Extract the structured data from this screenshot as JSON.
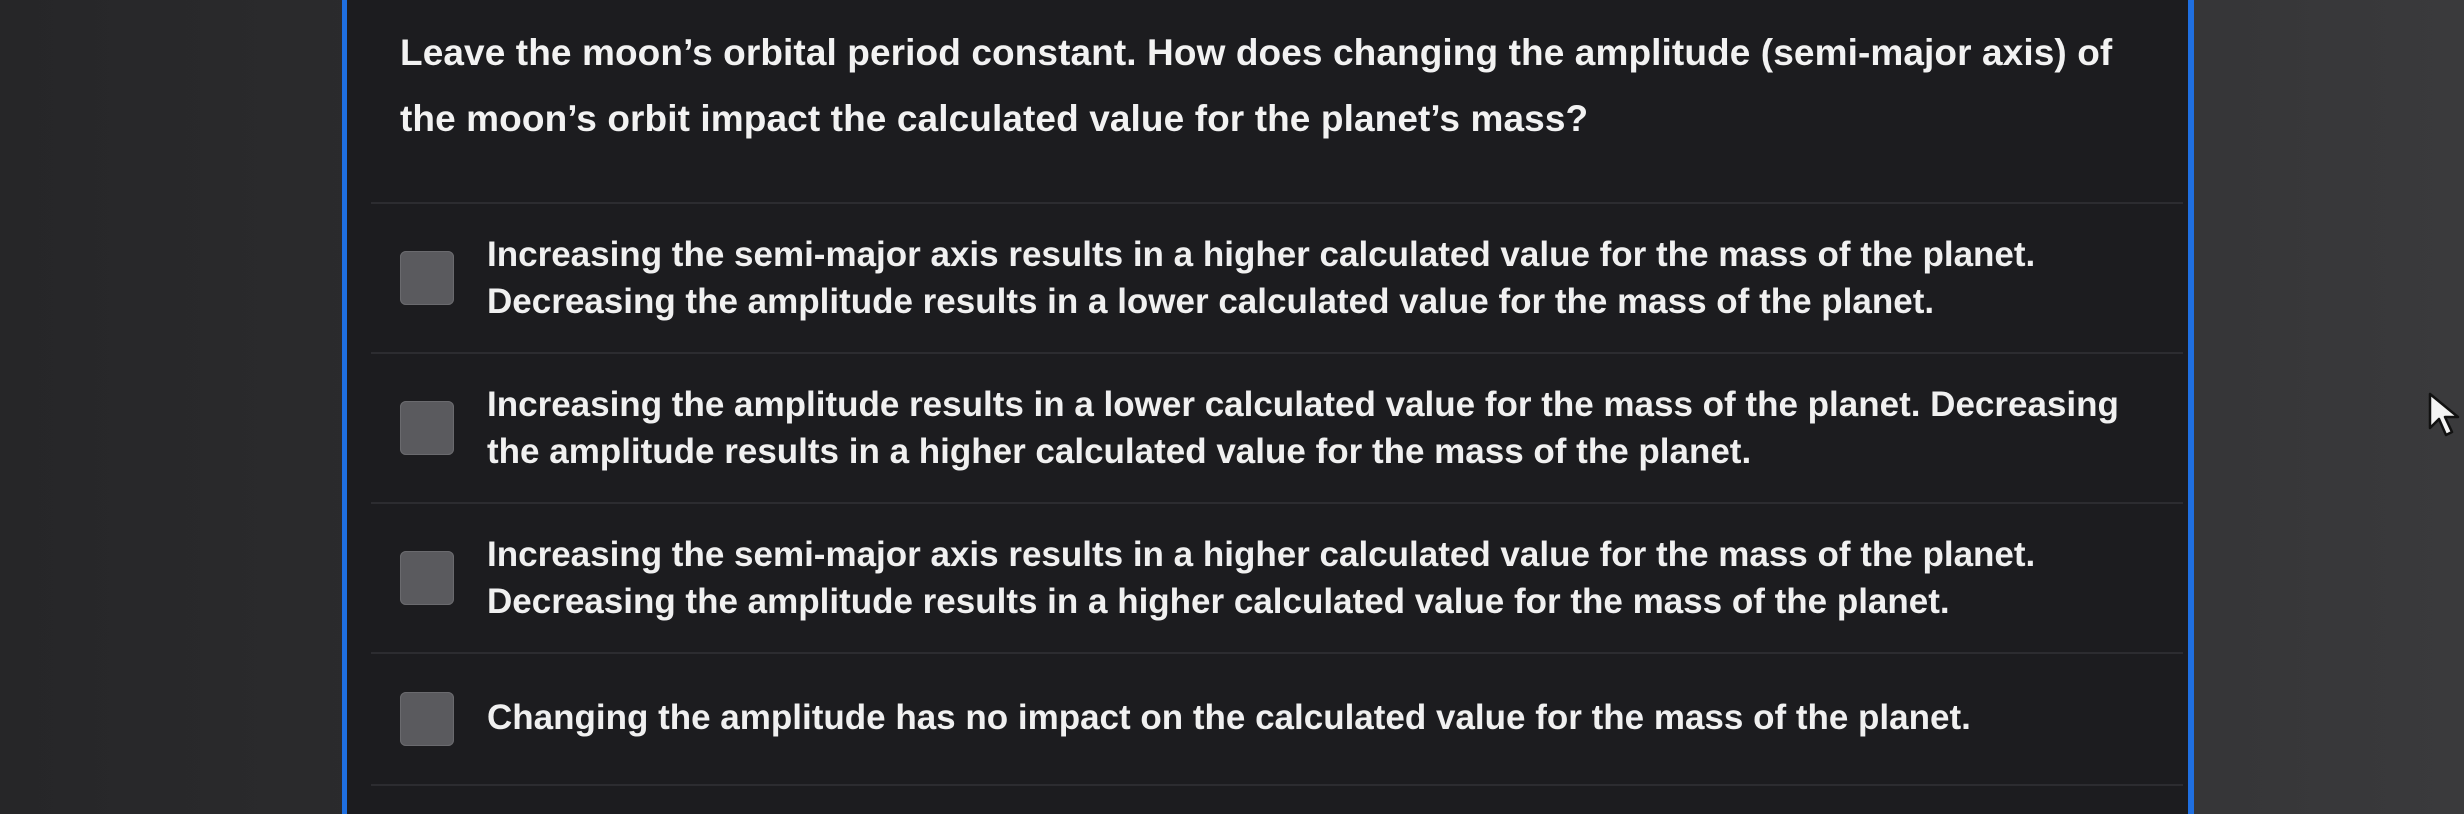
{
  "question": {
    "text": "Leave the moon’s orbital period constant. How does changing the amplitude (semi-major axis) of the moon’s orbit impact the calculated value for the planet’s mass?"
  },
  "options": [
    {
      "label": "Increasing the semi-major axis results in a higher calculated value for the mass of the planet. Decreasing the amplitude results in a lower calculated value for the mass of the planet.",
      "checked": false
    },
    {
      "label": "Increasing the amplitude results in a lower calculated value for the mass of the planet. Decreasing the amplitude results in a higher calculated value for the mass of the planet.",
      "checked": false
    },
    {
      "label": "Increasing the semi-major axis results in a higher calculated value for the mass of the planet. Decreasing the amplitude results in a higher calculated value for the mass of the planet.",
      "checked": false
    },
    {
      "label": "Changing the amplitude has no impact on the calculated value for the mass of the planet.",
      "checked": false
    }
  ],
  "colors": {
    "panel_border": "#1f6fe0",
    "panel_background": "#1c1c1f",
    "checkbox": "#5a5a5e",
    "text": "#f0f0f0"
  },
  "icons": {
    "pointer": "mouse-pointer-icon"
  }
}
